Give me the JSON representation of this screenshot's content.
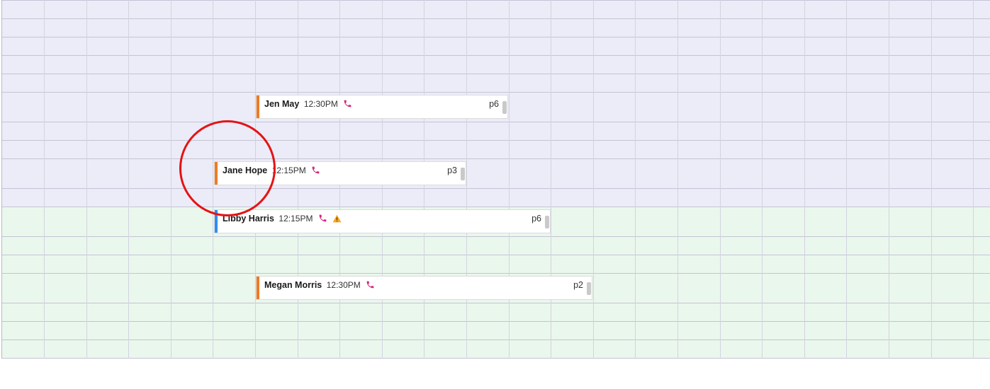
{
  "calendar": {
    "events": [
      {
        "name": "Jen May",
        "time": "12:30PM",
        "page": "p6",
        "bar_color": "#f07a22",
        "icons": [
          "phone-icon"
        ]
      },
      {
        "name": "Jane Hope",
        "time": "12:15PM",
        "page": "p3",
        "bar_color": "#f07a22",
        "icons": [
          "phone-icon"
        ]
      },
      {
        "name": "Libby Harris",
        "time": "12:15PM",
        "page": "p6",
        "bar_color": "#2c8ef5",
        "icons": [
          "phone-icon",
          "warning-icon"
        ]
      },
      {
        "name": "Megan Morris",
        "time": "12:30PM",
        "page": "p2",
        "bar_color": "#f07a22",
        "icons": [
          "phone-icon"
        ]
      }
    ]
  },
  "colors": {
    "upper_band": "#ececf8",
    "lower_band": "#eaf7ed",
    "phone": "#d6267a",
    "warning": "#f5a623",
    "annotation": "#e41414"
  }
}
